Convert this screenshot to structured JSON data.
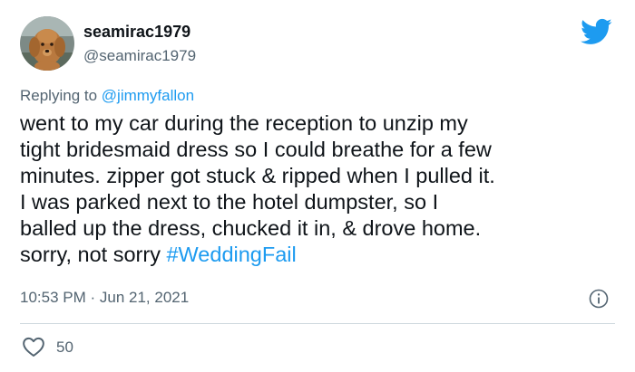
{
  "author": {
    "display_name": "seamirac1979",
    "handle": "@seamirac1979",
    "avatar_icon": "dog-avatar"
  },
  "platform_icon": "twitter-bird-icon",
  "reply": {
    "prefix": "Replying to ",
    "handle": "@jimmyfallon"
  },
  "tweet": {
    "lines": [
      "went to my car during the reception to unzip my",
      "tight bridesmaid dress so I could breathe for a few",
      "minutes. zipper got stuck & ripped when I pulled it.",
      "I was parked next to the hotel dumpster, so I",
      "balled up the dress, chucked it in, & drove home."
    ],
    "last_line_text": "sorry, not sorry ",
    "hashtag": "#WeddingFail"
  },
  "meta": {
    "time": "10:53 PM",
    "separator": " · ",
    "date": "Jun 21, 2021"
  },
  "stats": {
    "likes": "50"
  },
  "colors": {
    "link_blue": "#1d9bf0",
    "text": "#0f1419",
    "secondary": "#536471",
    "divider": "#cfd9de"
  }
}
